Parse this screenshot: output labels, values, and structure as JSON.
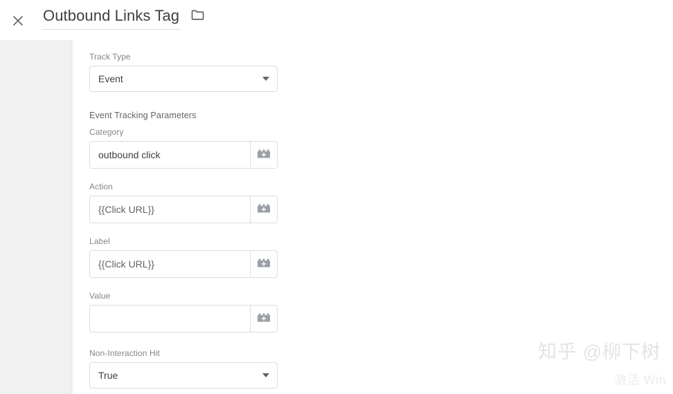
{
  "header": {
    "close_icon": "close-icon",
    "title": "Outbound Links Tag",
    "folder_icon": "folder-icon"
  },
  "form": {
    "track_type": {
      "label": "Track Type",
      "value": "Event",
      "icon": "chevron-down-icon"
    },
    "section_title": "Event Tracking Parameters",
    "fields": [
      {
        "label": "Category",
        "value": "outbound click",
        "placeholder": "",
        "is_variable": false,
        "button_icon": "variable-picker-icon"
      },
      {
        "label": "Action",
        "value": "{{Click URL}}",
        "placeholder": "",
        "is_variable": true,
        "button_icon": "variable-picker-icon"
      },
      {
        "label": "Label",
        "value": "{{Click URL}}",
        "placeholder": "",
        "is_variable": true,
        "button_icon": "variable-picker-icon"
      },
      {
        "label": "Value",
        "value": "",
        "placeholder": "",
        "is_variable": false,
        "button_icon": "variable-picker-icon"
      }
    ],
    "non_interaction": {
      "label": "Non-Interaction Hit",
      "value": "True",
      "icon": "chevron-down-icon"
    }
  },
  "watermarks": {
    "zhihu": "知乎 @柳下树",
    "activate": "激活 Win"
  },
  "colors": {
    "text_primary": "#3c4043",
    "text_secondary": "#80868b",
    "border": "#dadce0",
    "rail": "#f1f1f1",
    "icon_grey": "#9aa0a6"
  }
}
